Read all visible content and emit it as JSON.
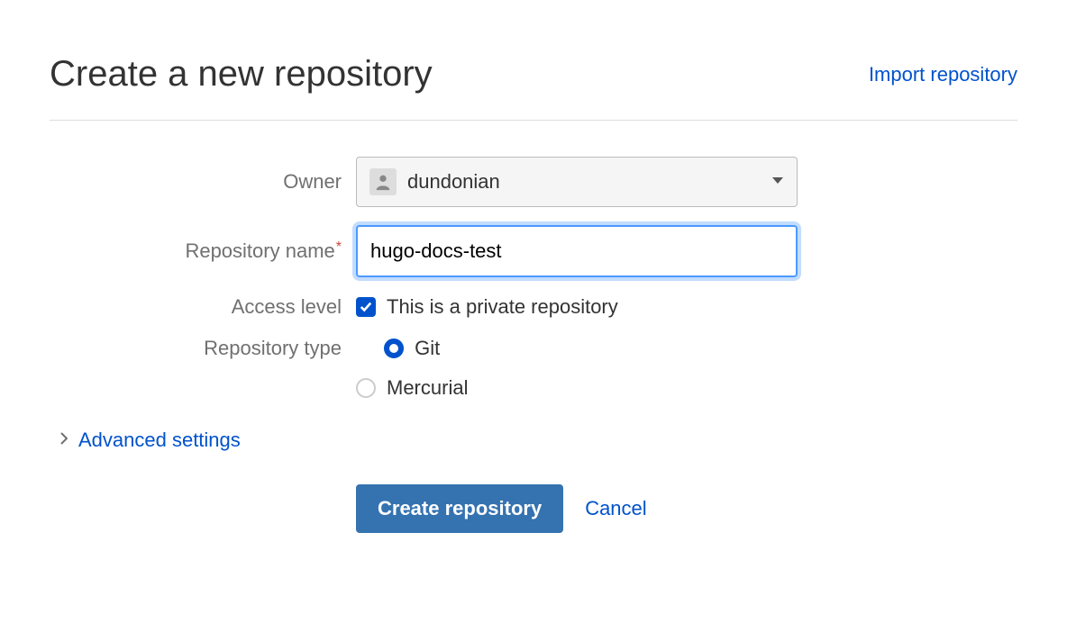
{
  "header": {
    "title": "Create a new repository",
    "import_link": "Import repository"
  },
  "form": {
    "owner": {
      "label": "Owner",
      "value": "dundonian"
    },
    "repo_name": {
      "label": "Repository name",
      "value": "hugo-docs-test"
    },
    "access_level": {
      "label": "Access level",
      "checkbox_label": "This is a private repository",
      "checked": true
    },
    "repo_type": {
      "label": "Repository type",
      "options": {
        "git": "Git",
        "mercurial": "Mercurial"
      },
      "selected": "git"
    },
    "advanced": "Advanced settings",
    "submit": "Create repository",
    "cancel": "Cancel"
  }
}
